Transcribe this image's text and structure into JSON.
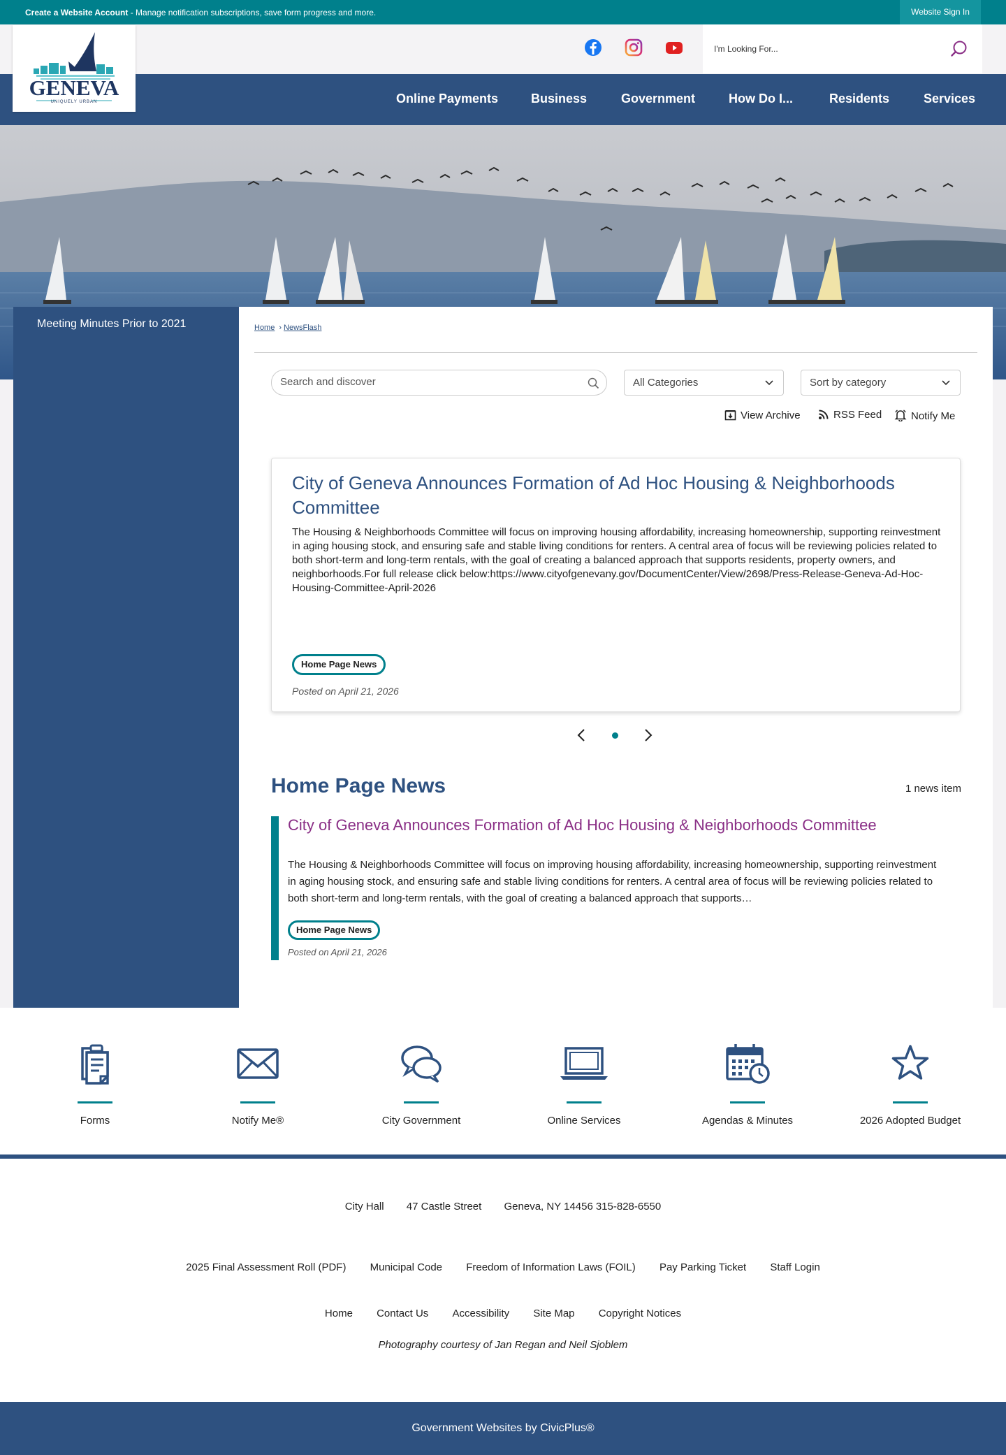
{
  "topbar": {
    "create_account": "Create a Website Account",
    "message": " - Manage notification subscriptions, save form progress and more.",
    "sign_in": "Website Sign In"
  },
  "logo": {
    "name": "GENEVA",
    "tagline": "UNIQUELY URBAN"
  },
  "search": {
    "placeholder": "I'm Looking For..."
  },
  "nav": {
    "items": [
      "Online Payments",
      "Business",
      "Government",
      "How Do I...",
      "Residents",
      "Services"
    ]
  },
  "sidebar": {
    "link": "Meeting Minutes Prior to 2021"
  },
  "breadcrumb": {
    "home": "Home",
    "sep": "›",
    "current": "NewsFlash"
  },
  "filters": {
    "search_placeholder": "Search and discover",
    "category": "All Categories",
    "sort": "Sort by category"
  },
  "actions": {
    "archive": "View Archive",
    "rss": "RSS Feed",
    "notify": "Notify Me"
  },
  "featured": {
    "title": "City of Geneva Announces Formation of Ad Hoc Housing & Neighborhoods Committee",
    "body": "The Housing & Neighborhoods Committee will focus on improving housing affordability, increasing homeownership, supporting reinvestment in aging housing stock, and ensuring safe and stable living conditions for renters. A central area of focus will be reviewing policies related to both short-term and long-term rentals, with the goal of creating a balanced approach that supports residents, property owners, and neighborhoods.For full release click below:https://www.cityofgenevany.gov/DocumentCenter/View/2698/Press-Release-Geneva-Ad-Hoc-Housing-Committee-April-2026",
    "tag": "Home Page News",
    "posted": "Posted on April 21, 2026"
  },
  "section": {
    "title": "Home Page News",
    "count": "1 news item"
  },
  "news_item": {
    "title": "City of Geneva Announces Formation of Ad Hoc Housing & Neighborhoods Committee",
    "body": "The Housing & Neighborhoods Committee will focus on improving housing affordability, increasing homeownership, supporting reinvestment in aging housing stock, and ensuring safe and stable living conditions for renters. A central area of focus will be reviewing policies related to both short-term and long-term rentals, with the goal of creating a balanced approach that supports…",
    "tag": "Home Page News",
    "posted": "Posted on April 21, 2026"
  },
  "quick_links": [
    {
      "label": "Forms",
      "icon": "forms-icon"
    },
    {
      "label": "Notify Me®",
      "icon": "envelope-icon"
    },
    {
      "label": "City Government",
      "icon": "chat-bubbles-icon"
    },
    {
      "label": "Online Services",
      "icon": "laptop-icon"
    },
    {
      "label": "Agendas & Minutes",
      "icon": "calendar-clock-icon"
    },
    {
      "label": "2026 Adopted Budget",
      "icon": "star-icon"
    }
  ],
  "footer": {
    "address": [
      "City Hall",
      "47 Castle Street",
      "Geneva, NY 14456",
      "315-828-6550"
    ],
    "links_row1": [
      "2025 Final Assessment Roll (PDF)",
      "Municipal Code",
      "Freedom of Information Laws (FOIL)",
      "Pay Parking Ticket",
      "Staff Login"
    ],
    "links_row2": [
      "Home",
      "Contact Us",
      "Accessibility",
      "Site Map",
      "Copyright Notices"
    ],
    "credit": "Photography courtesy of Jan Regan and Neil Sjoblem",
    "civicplus": "Government Websites by CivicPlus®"
  },
  "colors": {
    "teal": "#00808c",
    "navy": "#2e5180",
    "purple": "#8a2f86"
  }
}
